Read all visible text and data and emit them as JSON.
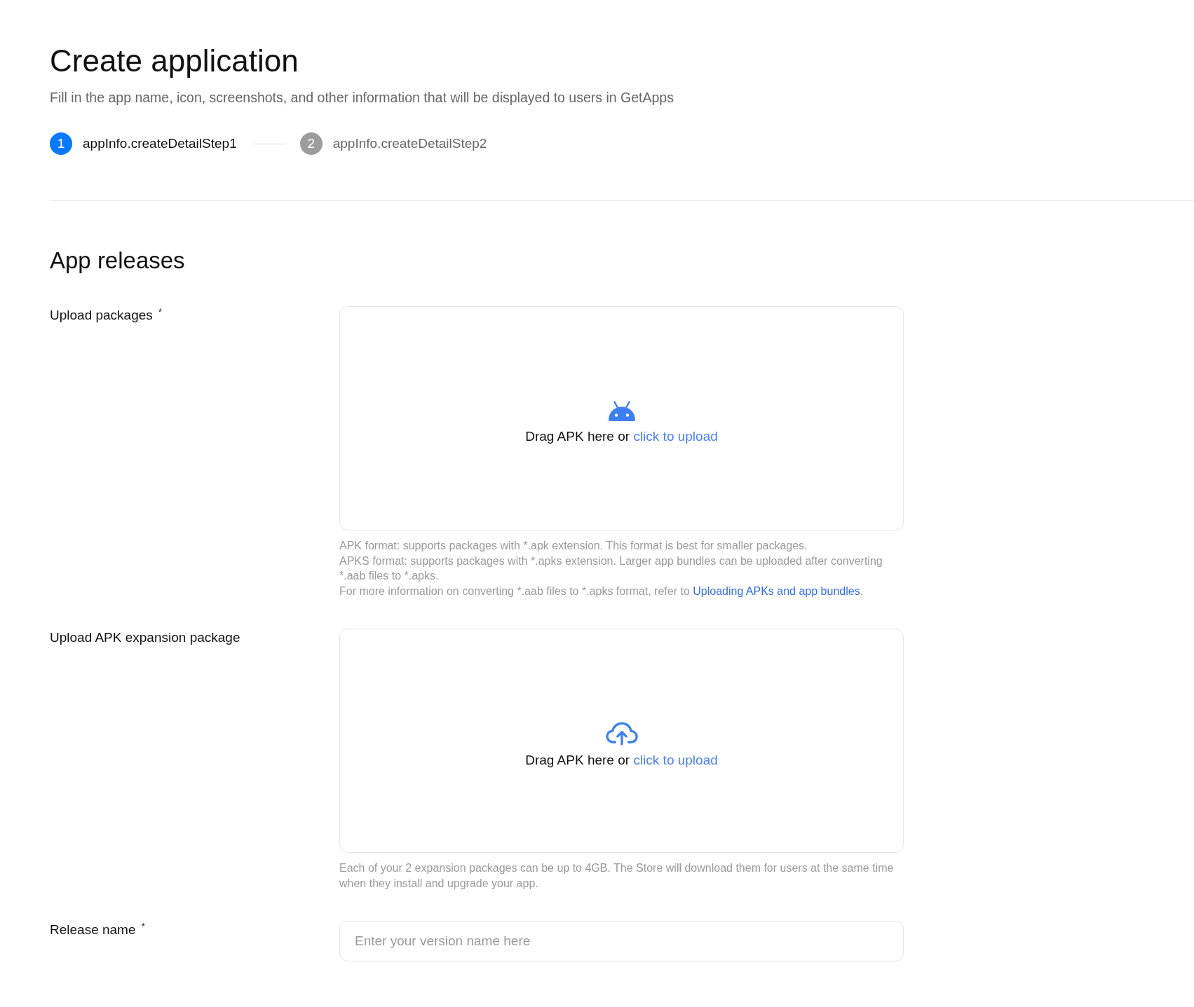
{
  "header": {
    "title": "Create application",
    "subtitle": "Fill in the app name, icon, screenshots, and other information that will be displayed to users in GetApps"
  },
  "steps": [
    {
      "number": "1",
      "label": "appInfo.createDetailStep1",
      "selected": true
    },
    {
      "number": "2",
      "label": "appInfo.createDetailStep2",
      "selected": false
    }
  ],
  "section": {
    "title": "App releases"
  },
  "fields": [
    {
      "kind": "package_upload",
      "label": "Upload packages",
      "required_mark": "*",
      "drop_text": "Drag APK here or",
      "link": "click to upload",
      "help": [
        {
          "text": "APK format: supports packages with *.apk extension. This format is best for smaller packages."
        },
        {
          "text": "APKS format: supports packages with *.apks extension. Larger app bundles can be uploaded after converting *.aab files to *.apks."
        },
        {
          "text": "For more information on converting *.aab files to *.apks format, refer to",
          "link": "Uploading APKs and app bundles",
          "after": "."
        }
      ]
    },
    {
      "kind": "expansion_upload",
      "label": "Upload APK expansion package",
      "drop_text": "Drag APK here or",
      "link": "click to upload",
      "help": [
        {
          "text": "Each of your 2 expansion packages can be up to 4GB. The Store will download them for users at the same time when they install and upgrade your app."
        }
      ]
    },
    {
      "kind": "text_input",
      "label": "Release name",
      "required_mark": "*",
      "placeholder": "Enter your version name here"
    }
  ]
}
